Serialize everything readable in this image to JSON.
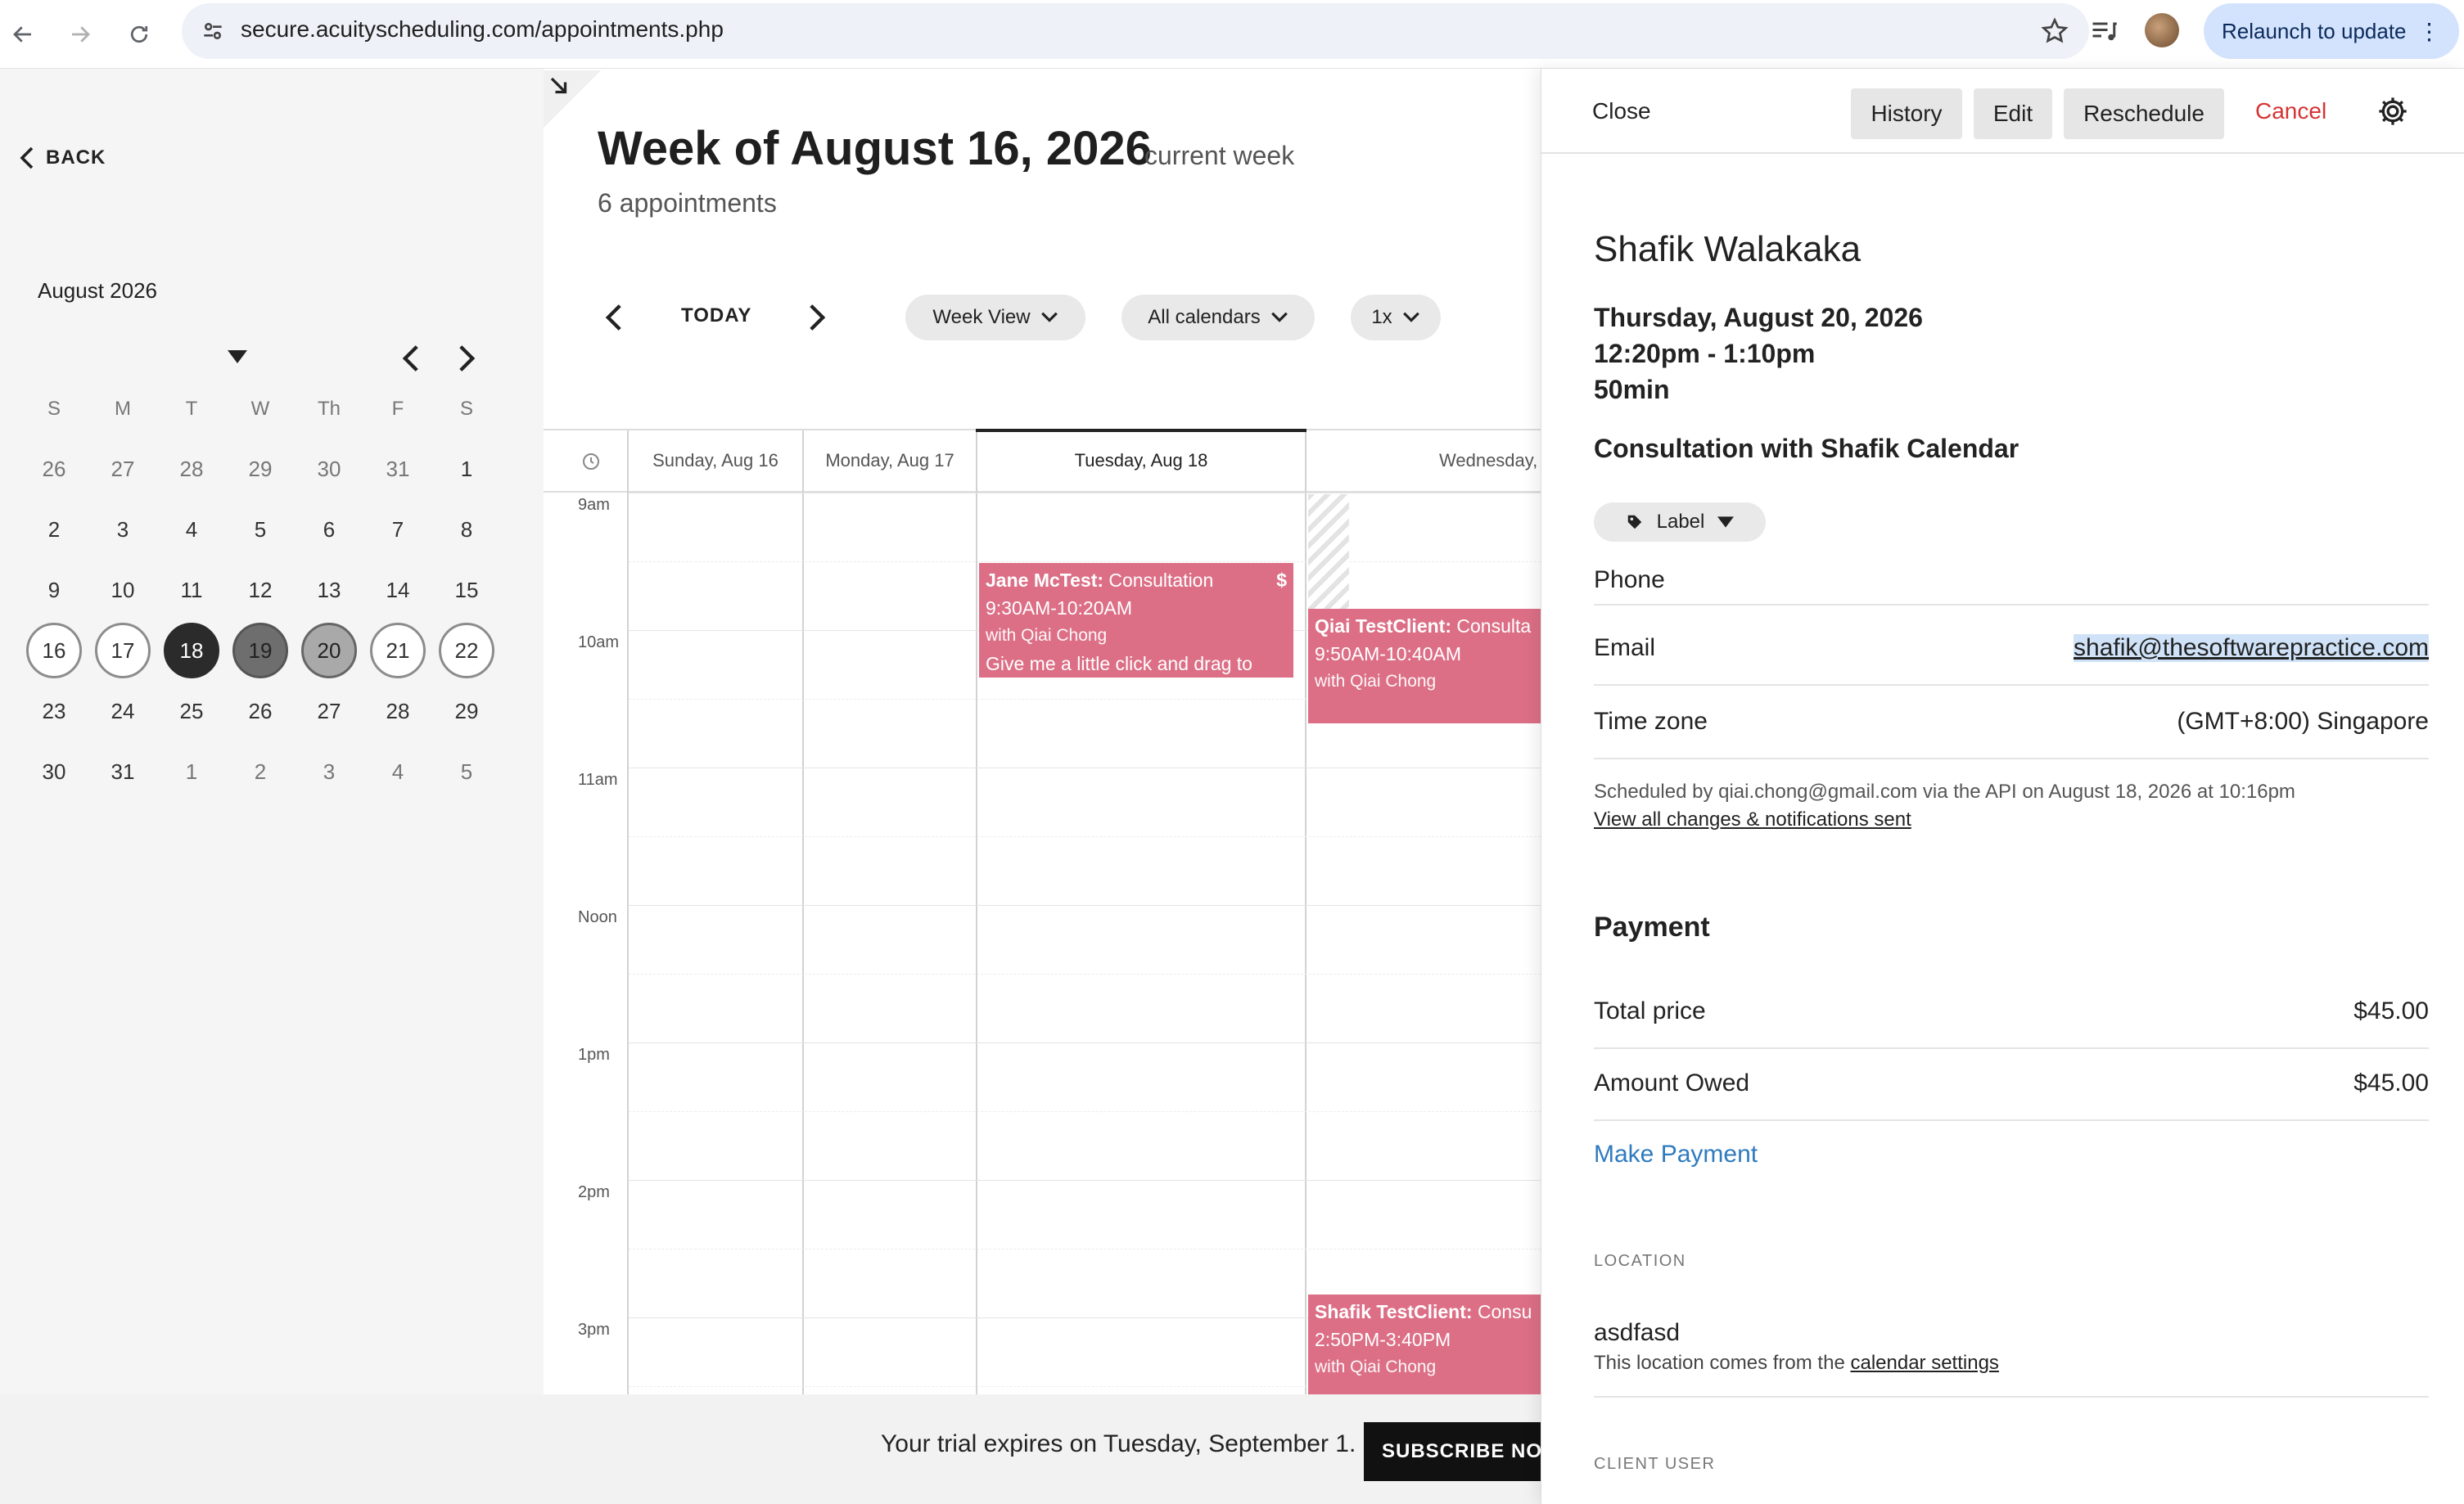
{
  "browser": {
    "url": "secure.acuityscheduling.com/appointments.php",
    "relaunch_label": "Relaunch to update"
  },
  "sidebar": {
    "back_label": "BACK",
    "month_label": "August 2026",
    "weekday_headers": [
      "S",
      "M",
      "T",
      "W",
      "Th",
      "F",
      "S"
    ],
    "weeks": [
      [
        "26",
        "27",
        "28",
        "29",
        "30",
        "31",
        "1"
      ],
      [
        "2",
        "3",
        "4",
        "5",
        "6",
        "7",
        "8"
      ],
      [
        "9",
        "10",
        "11",
        "12",
        "13",
        "14",
        "15"
      ],
      [
        "16",
        "17",
        "18",
        "19",
        "20",
        "21",
        "22"
      ],
      [
        "23",
        "24",
        "25",
        "26",
        "27",
        "28",
        "29"
      ],
      [
        "30",
        "31",
        "1",
        "2",
        "3",
        "4",
        "5"
      ]
    ]
  },
  "main": {
    "week_title": "Week of August 16, 2026",
    "current_week_label": "current week",
    "appointment_count": "6 appointments",
    "today_label": "TODAY",
    "view_select": "Week View",
    "calendars_select": "All calendars",
    "zoom_select": "1x",
    "day_headers": [
      "Sunday, Aug 16",
      "Monday, Aug 17",
      "Tuesday, Aug 18",
      "Wednesday, Aug"
    ],
    "time_labels": [
      "9am",
      "10am",
      "11am",
      "Noon",
      "1pm",
      "2pm",
      "3pm"
    ],
    "events": [
      {
        "client": "Jane McTest:",
        "type": "Consultation",
        "badge": "$",
        "time": "9:30AM-10:20AM",
        "with": "with Qiai Chong",
        "note": "Give me a little click and drag to"
      },
      {
        "client": "Qiai TestClient:",
        "type": "Consulta",
        "time": "9:50AM-10:40AM",
        "with": "with Qiai Chong"
      },
      {
        "client": "Shafik TestClient:",
        "type": "Consu",
        "time": "2:50PM-3:40PM",
        "with": "with Qiai Chong"
      }
    ]
  },
  "trial": {
    "text": "Your trial expires on Tuesday, September 1.",
    "subscribe_label": "SUBSCRIBE NO"
  },
  "panel": {
    "close_label": "Close",
    "history_label": "History",
    "edit_label": "Edit",
    "reschedule_label": "Reschedule",
    "cancel_label": "Cancel",
    "client_name": "Shafik Walakaka",
    "date": "Thursday, August 20, 2026",
    "time_range": "12:20pm - 1:10pm",
    "duration": "50min",
    "appointment_type": "Consultation with Shafik Calendar",
    "label_button": "Label",
    "phone_label": "Phone",
    "email_label": "Email",
    "email_value": "shafik@thesoftwarepractice.com",
    "timezone_label": "Time zone",
    "timezone_value": "(GMT+8:00) Singapore",
    "scheduled_by": "Scheduled by qiai.chong@gmail.com via the API on August 18, 2026 at 10:16pm",
    "view_changes_link": "View all changes & notifications sent",
    "payment_heading": "Payment",
    "total_price_label": "Total price",
    "total_price_value": "$45.00",
    "amount_owed_label": "Amount Owed",
    "amount_owed_value": "$45.00",
    "make_payment_label": "Make Payment",
    "location_caption": "LOCATION",
    "location_value": "asdfasd",
    "location_note_prefix": "This location comes from the",
    "location_note_link": "calendar settings",
    "client_user_caption": "CLIENT USER"
  },
  "colors": {
    "event_pink": "#dc6f86",
    "cancel_red": "#d63333",
    "link_blue": "#2f7bbf",
    "relaunch_bg": "#d3e3fd"
  }
}
